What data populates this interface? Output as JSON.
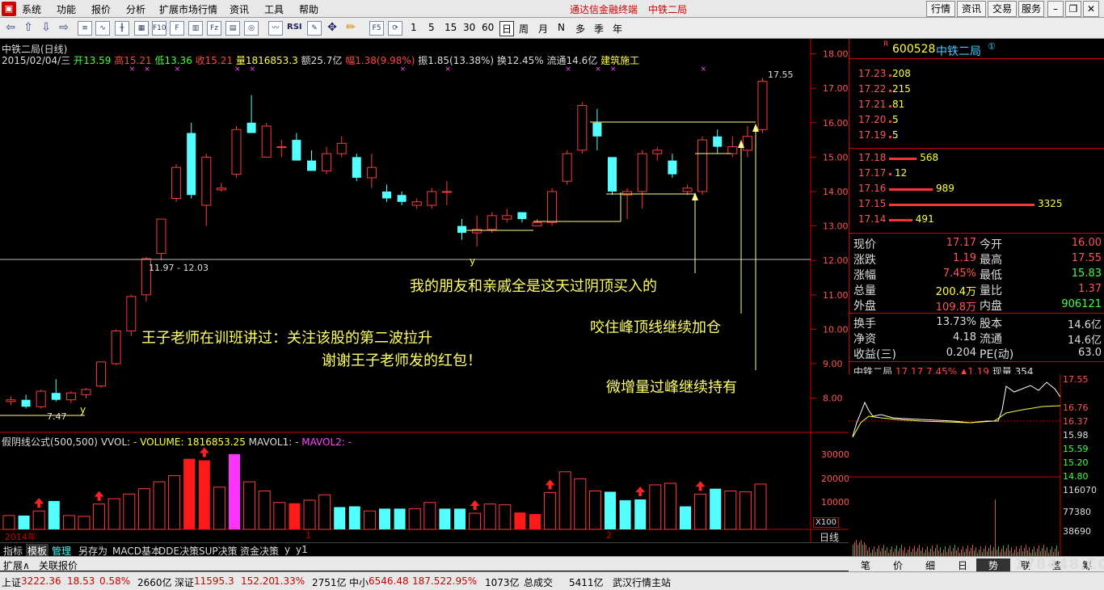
{
  "menubar": {
    "items": [
      "系统",
      "功能",
      "报价",
      "分析",
      "扩展市场行情",
      "资讯",
      "工具",
      "帮助"
    ],
    "title": "通达信金融终端",
    "stock_title": "中铁二局",
    "buttons": [
      "行情",
      "资讯",
      "交易",
      "服务"
    ]
  },
  "toolbar": {
    "periods": [
      "1",
      "5",
      "15",
      "30",
      "60",
      "日",
      "周",
      "月",
      "N",
      "多",
      "季",
      "年"
    ],
    "active_period": "日"
  },
  "chart": {
    "title": "中铁二局(日线)",
    "info_date": "2015/02/04/三",
    "info_open_label": "开",
    "info_open": "13.59",
    "info_high_label": "高",
    "info_high": "15.21",
    "info_low_label": "低",
    "info_low": "13.36",
    "info_close_label": "收",
    "info_close": "15.21",
    "info_vol_label": "量",
    "info_vol": "1816853.3",
    "info_amt_label": "额",
    "info_amt": "25.7亿",
    "info_pct_label": "幅",
    "info_pct": "1.38(9.98%)",
    "info_amp_label": "振",
    "info_amp": "1.85(13.38%)",
    "info_turn_label": "换",
    "info_turn": "12.45%",
    "info_float_label": "流通",
    "info_float": "14.6亿",
    "info_sector": "建筑施工",
    "label_1755": "17.55",
    "label_range": "11.97 - 12.03",
    "label_747": "7.47",
    "label_y1": "y",
    "label_y2": "y"
  },
  "annotations": {
    "a1": "我的朋友和亲戚全是这天过阴顶买入的",
    "a2": "咬住峰顶线继续加仓",
    "a3": "王子老师在训班讲过：关注该股的第二波拉升",
    "a4": "谢谢王子老师发的红包！",
    "a5": "微增量过峰继续持有"
  },
  "volume": {
    "formula": "假阴线公式(500,500)",
    "vol_label": "VVOL: -",
    "volume_text": "VOLUME: 1816853.25",
    "mavol1": "MAVOL1: -",
    "mavol2": "MAVOL2: -",
    "year_label": "2014年",
    "m1": "1",
    "m2": "2",
    "scale": "X100",
    "day_label": "日线"
  },
  "chart_data": {
    "type": "candlestick",
    "price_axis": [
      "18.00",
      "17.00",
      "16.00",
      "15.00",
      "14.00",
      "13.00",
      "12.00",
      "11.00",
      "10.00",
      "9.00",
      "8.00"
    ],
    "volume_axis": [
      "30000",
      "20000",
      "10000"
    ],
    "ylim": [
      7.5,
      18.2
    ],
    "ohlc": [
      [
        7.9,
        8.05,
        7.8,
        7.95,
        "r"
      ],
      [
        7.95,
        8.1,
        7.7,
        7.75,
        "c"
      ],
      [
        7.75,
        8.25,
        7.7,
        8.2,
        "r"
      ],
      [
        8.15,
        8.55,
        7.9,
        7.95,
        "c"
      ],
      [
        7.95,
        8.2,
        7.85,
        8.15,
        "r"
      ],
      [
        8.1,
        8.3,
        8.0,
        8.25,
        "r"
      ],
      [
        8.35,
        9.05,
        8.3,
        9.05,
        "r"
      ],
      [
        9.0,
        10.0,
        8.95,
        9.95,
        "r"
      ],
      [
        9.95,
        11.0,
        9.8,
        10.95,
        "r"
      ],
      [
        11.0,
        12.1,
        10.8,
        12.05,
        "r"
      ],
      [
        12.2,
        13.2,
        12.0,
        13.2,
        "r"
      ],
      [
        13.8,
        14.8,
        13.7,
        14.7,
        "r"
      ],
      [
        15.7,
        16.0,
        13.8,
        13.9,
        "c"
      ],
      [
        13.6,
        15.1,
        13.0,
        15.0,
        "r"
      ],
      [
        14.05,
        14.25,
        14.0,
        14.1,
        "r"
      ],
      [
        14.5,
        15.9,
        14.4,
        15.8,
        "r"
      ],
      [
        16.0,
        16.8,
        15.7,
        15.7,
        "c"
      ],
      [
        15.0,
        16.0,
        15.0,
        15.9,
        "r"
      ],
      [
        15.3,
        15.5,
        15.0,
        15.3,
        "r"
      ],
      [
        15.5,
        15.7,
        14.9,
        14.9,
        "c"
      ],
      [
        14.9,
        15.2,
        14.6,
        14.6,
        "c"
      ],
      [
        14.6,
        15.3,
        14.5,
        15.1,
        "r"
      ],
      [
        15.4,
        15.6,
        15.0,
        15.1,
        "r"
      ],
      [
        15.0,
        15.1,
        14.3,
        14.4,
        "c"
      ],
      [
        14.7,
        15.1,
        14.1,
        14.4,
        "r"
      ],
      [
        14.0,
        14.2,
        13.7,
        13.8,
        "c"
      ],
      [
        13.9,
        14.0,
        13.6,
        13.7,
        "c"
      ],
      [
        13.7,
        13.8,
        13.5,
        13.6,
        "r"
      ],
      [
        13.6,
        14.1,
        13.5,
        14.0,
        "r"
      ],
      [
        14.0,
        14.3,
        13.6,
        14.0,
        "r"
      ],
      [
        13.0,
        13.2,
        12.6,
        12.8,
        "c"
      ],
      [
        12.8,
        13.3,
        12.4,
        12.9,
        "r"
      ],
      [
        12.9,
        13.4,
        12.8,
        13.3,
        "r"
      ],
      [
        13.3,
        13.5,
        13.1,
        13.2,
        "r"
      ],
      [
        13.4,
        13.4,
        13.1,
        13.2,
        "c"
      ],
      [
        13.0,
        13.2,
        13.0,
        13.1,
        "r"
      ],
      [
        13.1,
        14.1,
        13.0,
        14.0,
        "r"
      ],
      [
        14.3,
        15.2,
        14.2,
        15.1,
        "r"
      ],
      [
        15.2,
        16.6,
        15.1,
        16.5,
        "r"
      ],
      [
        16.0,
        16.4,
        15.2,
        15.6,
        "c"
      ],
      [
        15.0,
        15.0,
        13.9,
        14.0,
        "c"
      ],
      [
        13.9,
        14.1,
        13.2,
        14.0,
        "r"
      ],
      [
        14.0,
        15.2,
        13.5,
        15.1,
        "r"
      ],
      [
        15.1,
        15.3,
        14.9,
        15.2,
        "r"
      ],
      [
        14.9,
        15.1,
        14.4,
        14.5,
        "c"
      ],
      [
        14.0,
        14.2,
        13.9,
        14.1,
        "r"
      ],
      [
        14.0,
        15.6,
        13.9,
        15.5,
        "r"
      ],
      [
        15.6,
        15.8,
        15.1,
        15.3,
        "c"
      ],
      [
        15.1,
        15.6,
        15.0,
        15.3,
        "r"
      ],
      [
        15.2,
        15.9,
        15.0,
        15.6,
        "r"
      ],
      [
        15.8,
        17.3,
        15.7,
        17.2,
        "r"
      ]
    ],
    "volume": [
      [
        18,
        "r"
      ],
      [
        18,
        "c"
      ],
      [
        24,
        "r"
      ],
      [
        37,
        "c"
      ],
      [
        18,
        "r"
      ],
      [
        17,
        "r"
      ],
      [
        33,
        "r"
      ],
      [
        40,
        "r"
      ],
      [
        46,
        "r"
      ],
      [
        53,
        "r"
      ],
      [
        62,
        "r"
      ],
      [
        70,
        "r"
      ],
      [
        92,
        "f"
      ],
      [
        90,
        "f"
      ],
      [
        55,
        "r"
      ],
      [
        98,
        "m"
      ],
      [
        62,
        "r"
      ],
      [
        50,
        "r"
      ],
      [
        35,
        "r"
      ],
      [
        34,
        "f"
      ],
      [
        38,
        "r"
      ],
      [
        45,
        "r"
      ],
      [
        29,
        "c"
      ],
      [
        30,
        "c"
      ],
      [
        24,
        "r"
      ],
      [
        27,
        "c"
      ],
      [
        27,
        "c"
      ],
      [
        27,
        "r"
      ],
      [
        35,
        "r"
      ],
      [
        27,
        "c"
      ],
      [
        27,
        "c"
      ],
      [
        21,
        "r"
      ],
      [
        33,
        "r"
      ],
      [
        32,
        "r"
      ],
      [
        22,
        "f"
      ],
      [
        20,
        "f"
      ],
      [
        48,
        "r"
      ],
      [
        75,
        "r"
      ],
      [
        66,
        "r"
      ],
      [
        50,
        "r"
      ],
      [
        49,
        "c"
      ],
      [
        38,
        "c"
      ],
      [
        39,
        "c"
      ],
      [
        58,
        "r"
      ],
      [
        60,
        "r"
      ],
      [
        30,
        "c"
      ],
      [
        46,
        "r"
      ],
      [
        53,
        "c"
      ],
      [
        50,
        "r"
      ],
      [
        49,
        "r"
      ],
      [
        59,
        "r"
      ]
    ]
  },
  "right_panel": {
    "code": "600528",
    "name": "中铁二局",
    "asks": [
      {
        "price": "17.23",
        "qty": "208"
      },
      {
        "price": "17.22",
        "qty": "215"
      },
      {
        "price": "17.21",
        "qty": "81"
      },
      {
        "price": "17.20",
        "qty": "5"
      },
      {
        "price": "17.19",
        "qty": "5"
      }
    ],
    "bids": [
      {
        "price": "17.18",
        "qty": "568",
        "bar": 0.19
      },
      {
        "price": "17.17",
        "qty": "12",
        "bar": 0.01
      },
      {
        "price": "17.16",
        "qty": "989",
        "bar": 0.3
      },
      {
        "price": "17.15",
        "qty": "3325",
        "bar": 1.0
      },
      {
        "price": "17.14",
        "qty": "491",
        "bar": 0.16
      }
    ],
    "stats": [
      {
        "l1": "现价",
        "v1": "17.17",
        "c1": "#ff5555",
        "l2": "今开",
        "v2": "16.00",
        "c2": "#ff5555"
      },
      {
        "l1": "涨跌",
        "v1": "1.19",
        "c1": "#ff5555",
        "l2": "最高",
        "v2": "17.55",
        "c2": "#ff5555"
      },
      {
        "l1": "涨幅",
        "v1": "7.45%",
        "c1": "#ff5555",
        "l2": "最低",
        "v2": "15.83",
        "c2": "#44ff44"
      },
      {
        "l1": "总量",
        "v1": "200.4万",
        "c1": "#ffff44",
        "l2": "量比",
        "v2": "1.37",
        "c2": "#ff5555"
      },
      {
        "l1": "外盘",
        "v1": "109.8万",
        "c1": "#ff5555",
        "l2": "内盘",
        "v2": "906121",
        "c2": "#44ff44"
      }
    ],
    "stats2": [
      {
        "l1": "换手",
        "v1": "13.73%",
        "l2": "股本",
        "v2": "14.6亿"
      },
      {
        "l1": "净资",
        "v1": "4.18",
        "l2": "流通",
        "v2": "14.6亿"
      },
      {
        "l1": "收益(三)",
        "v1": "0.204",
        "l2": "PE(动)",
        "v2": "63.0"
      }
    ],
    "mini_title": "中铁二局",
    "mini_price": "17.17",
    "mini_pct": "7.45%",
    "mini_chg": "▲1.19",
    "mini_vol": "现量 354",
    "mini_axis": [
      "17.55",
      "16.76",
      "16.37",
      "15.98",
      "15.59",
      "15.20",
      "14.80"
    ],
    "mini_vol_axis": [
      "116070",
      "77380",
      "38690"
    ],
    "tabs": [
      "笔",
      "价",
      "细",
      "日",
      "势",
      "联",
      "值",
      "筹"
    ],
    "active_tab": "势"
  },
  "tabs": {
    "items": [
      "指标",
      "模板",
      "管理",
      "另存为",
      "MACD基本",
      "DDE决策",
      "SUP决策",
      "资金决策",
      "y",
      "y1"
    ],
    "ext": [
      "扩展∧",
      "关联报价"
    ]
  },
  "status": {
    "sh_label": "上证",
    "sh_val": "3222.36",
    "sh_chg": "18.53",
    "sh_pct": "0.58%",
    "sh_amt": "2660亿",
    "sz_label": "深证",
    "sz_val": "11595.3",
    "sz_chg": "152.20",
    "sz_pct": "1.33%",
    "sz_amt": "2751亿",
    "zx_label": "中小",
    "zx_val": "6546.48",
    "zx_chg": "187.52",
    "zx_pct": "2.95%",
    "zx_amt": "1073亿",
    "total_label": "总成交",
    "total_val": "5411亿",
    "station": "武汉行情主站"
  },
  "watermark": "178448.COM"
}
